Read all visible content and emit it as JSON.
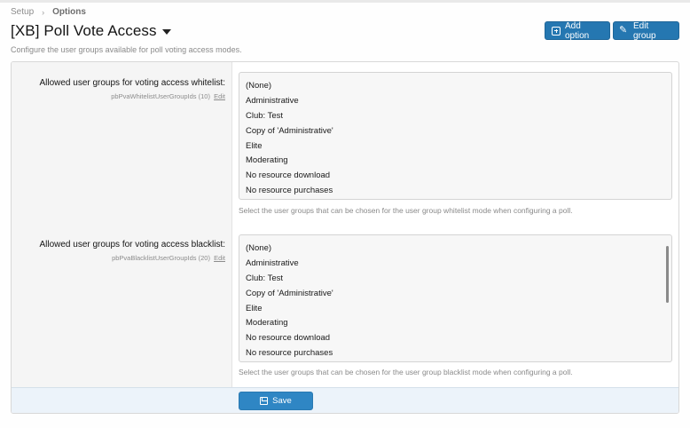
{
  "breadcrumb": {
    "root": "Setup",
    "current": "Options"
  },
  "header": {
    "title": "[XB] Poll Vote Access",
    "description": "Configure the user groups available for poll voting access modes.",
    "add_option_label": "Add option",
    "edit_group_label": "Edit group"
  },
  "whitelist": {
    "label": "Allowed user groups for voting access whitelist:",
    "option_id": "pbPvaWhitelistUserGroupIds (10)",
    "edit_label": "Edit",
    "options": [
      "(None)",
      "Administrative",
      "Club: Test",
      "Copy of 'Administrative'",
      "Elite",
      "Moderating",
      "No resource download",
      "No resource purchases"
    ],
    "hint": "Select the user groups that can be chosen for the user group whitelist mode when configuring a poll."
  },
  "blacklist": {
    "label": "Allowed user groups for voting access blacklist:",
    "option_id": "pbPvaBlacklistUserGroupIds (20)",
    "edit_label": "Edit",
    "options": [
      "(None)",
      "Administrative",
      "Club: Test",
      "Copy of 'Administrative'",
      "Elite",
      "Moderating",
      "No resource download",
      "No resource purchases"
    ],
    "hint": "Select the user groups that can be chosen for the user group blacklist mode when configuring a poll."
  },
  "footer": {
    "save_label": "Save"
  },
  "colors": {
    "primary": "#2577b1",
    "footer_bg": "#ecf3fa"
  }
}
